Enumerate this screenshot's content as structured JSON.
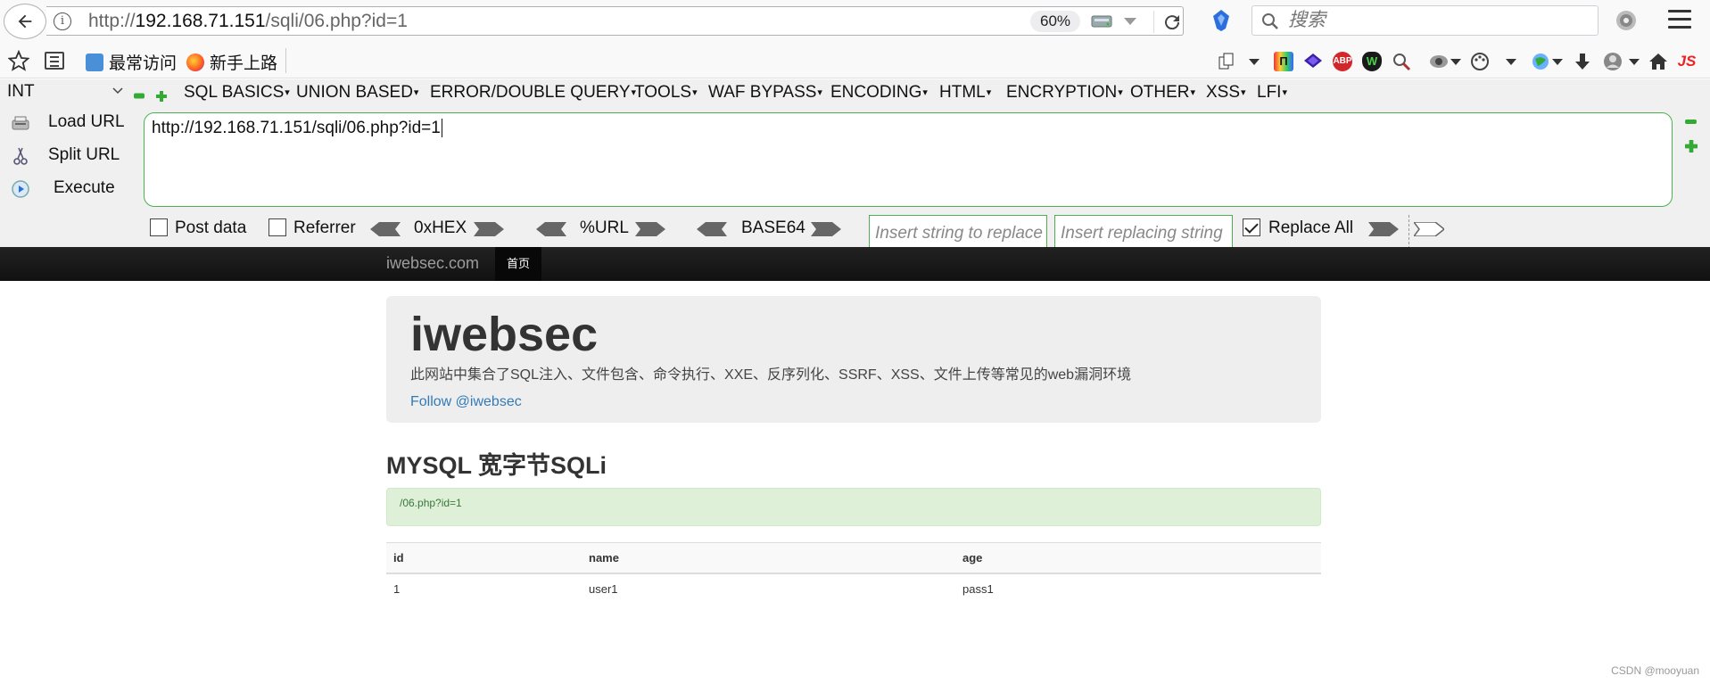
{
  "browser": {
    "url_prefix": "http://",
    "url_host": "192.168.71.151",
    "url_path": "/sqli/06.php?id=1",
    "zoom": "60%",
    "search_placeholder": "搜索"
  },
  "bookmarks": {
    "items": [
      {
        "label": "最常访问"
      },
      {
        "label": "新手上路"
      }
    ],
    "extensions": [
      "page-icon",
      "pi-ext",
      "layers-ext",
      "ABP",
      "W",
      "zoom-ext",
      "eye-ext",
      "palette-ext",
      "globe-ext",
      "download-icon",
      "avatar-ext",
      "home-icon",
      "JS"
    ]
  },
  "hackbar": {
    "select_value": "INT",
    "menu": [
      "SQL BASICS",
      "UNION BASED",
      "ERROR/DOUBLE QUERY",
      "TOOLS",
      "WAF BYPASS",
      "ENCODING",
      "HTML",
      "ENCRYPTION",
      "OTHER",
      "XSS",
      "LFI"
    ],
    "load_url": "Load URL",
    "split_url": "Split URL",
    "execute": "Execute",
    "url_value": "http://192.168.71.151/sqli/06.php?id=1",
    "post_data": "Post data",
    "referrer": "Referrer",
    "hex": "0xHEX",
    "url_enc": "%URL",
    "base64": "BASE64",
    "replace_placeholder": "Insert string to replace",
    "replacing_placeholder": "Insert replacing string",
    "replace_all": "Replace All"
  },
  "site": {
    "brand": "iwebsec.com",
    "nav_home": "首页",
    "title": "iwebsec",
    "description": "此网站中集合了SQL注入、文件包含、命令执行、XXE、反序列化、SSRF、XSS、文件上传等常见的web漏洞环境",
    "follow": "Follow @iwebsec",
    "heading": "MYSQL 宽字节SQLi",
    "alert": "/06.php?id=1",
    "table": {
      "headers": [
        "id",
        "name",
        "age"
      ],
      "rows": [
        [
          "1",
          "user1",
          "pass1"
        ]
      ]
    }
  },
  "watermark": "CSDN @mooyuan"
}
